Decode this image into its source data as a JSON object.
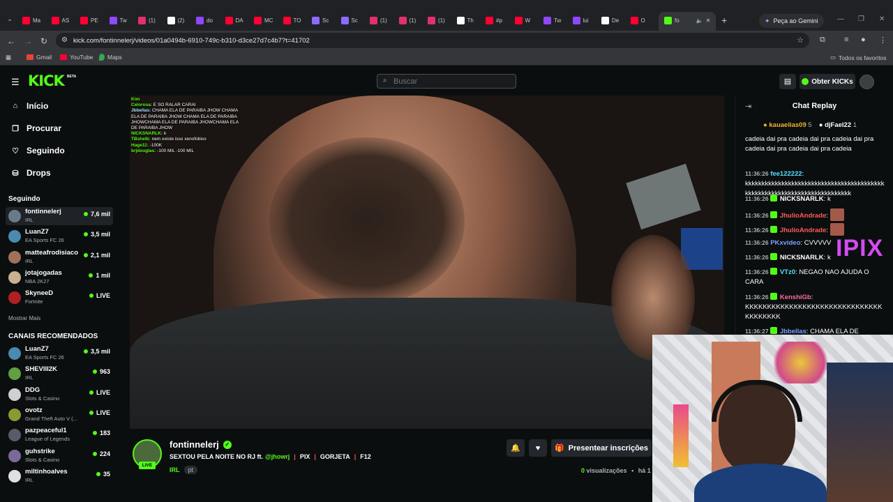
{
  "browser": {
    "tabs": [
      {
        "label": "Ma",
        "color": "#ff0033"
      },
      {
        "label": "AS",
        "color": "#ff0033"
      },
      {
        "label": "PE",
        "color": "#ff0033"
      },
      {
        "label": "Tw",
        "color": "#9146ff"
      },
      {
        "label": "(1)",
        "color": "#e1306c"
      },
      {
        "label": "(2)",
        "color": "#ffffff"
      },
      {
        "label": "do",
        "color": "#9146ff"
      },
      {
        "label": "DA",
        "color": "#ff0033"
      },
      {
        "label": "MC",
        "color": "#ff0033"
      },
      {
        "label": "TO",
        "color": "#ff0033"
      },
      {
        "label": "Sc",
        "color": "#8a6cff"
      },
      {
        "label": "Sc",
        "color": "#8a6cff"
      },
      {
        "label": "(1)",
        "color": "#e1306c"
      },
      {
        "label": "(1)",
        "color": "#e1306c"
      },
      {
        "label": "(1)",
        "color": "#e1306c"
      },
      {
        "label": "Th",
        "color": "#ffffff"
      },
      {
        "label": "#p",
        "color": "#ff0033"
      },
      {
        "label": "W",
        "color": "#ff0033"
      },
      {
        "label": "Tw",
        "color": "#9146ff"
      },
      {
        "label": "lui",
        "color": "#9146ff"
      },
      {
        "label": "De",
        "color": "#ffffff"
      },
      {
        "label": "O",
        "color": "#ff0033"
      }
    ],
    "active_tab": {
      "label": "fo",
      "color": "#53fc18"
    },
    "gemini_label": "Peça ao Gemini",
    "url": "kick.com/fontinnelerj/videos/01a0494b-6910-749c-b310-d3ce27d7c4b7?t=41702",
    "bookmarks": [
      {
        "label": "Gmail",
        "color": "#ea4335"
      },
      {
        "label": "YouTube",
        "color": "#ff0033"
      },
      {
        "label": "Maps",
        "color": "#34a853"
      }
    ],
    "all_favorites": "Todos os favoritos"
  },
  "kick": {
    "logo": "KICK",
    "beta": "BETA",
    "search_placeholder": "Buscar",
    "get_kicks": "Obter KICKs"
  },
  "sidebar": {
    "nav": [
      {
        "label": "Início",
        "icon": "home-icon",
        "glyph": "⌂"
      },
      {
        "label": "Procurar",
        "icon": "browse-icon",
        "glyph": "❐"
      },
      {
        "label": "Seguindo",
        "icon": "heart-icon",
        "glyph": "♡"
      },
      {
        "label": "Drops",
        "icon": "drops-icon",
        "glyph": "⛁"
      }
    ],
    "following_title": "Seguindo",
    "following": [
      {
        "name": "fontinnelerj",
        "category": "IRL",
        "viewers": "7,6 mil",
        "color": "#6a7a88"
      },
      {
        "name": "LuanZ7",
        "category": "EA Sports FC 26",
        "viewers": "3,5 mil",
        "color": "#4a8ab0"
      },
      {
        "name": "matteafrodisiaco",
        "category": "IRL",
        "viewers": "2,1 mil",
        "color": "#a0705a"
      },
      {
        "name": "jotajogadas",
        "category": "NBA 2K27",
        "viewers": "1 mil",
        "color": "#c8b090"
      },
      {
        "name": "SkyneeD",
        "category": "Fortnite",
        "viewers": "LIVE",
        "color": "#b02020"
      }
    ],
    "show_more": "Mostrar Mais",
    "recommended_title": "CANAIS RECOMENDADOS",
    "recommended": [
      {
        "name": "LuanZ7",
        "category": "EA Sports FC 26",
        "viewers": "3,5 mil",
        "color": "#4a8ab0"
      },
      {
        "name": "SHEVIII2K",
        "category": "IRL",
        "viewers": "963",
        "color": "#60a040"
      },
      {
        "name": "DDG",
        "category": "Slots & Casino",
        "viewers": "LIVE",
        "color": "#d0d0d0"
      },
      {
        "name": "ovotz",
        "category": "Grand Theft Auto V (...",
        "viewers": "LIVE",
        "color": "#8a9a30"
      },
      {
        "name": "pazpeaceful1",
        "category": "League of Legends",
        "viewers": "183",
        "color": "#5a5a6a"
      },
      {
        "name": "guhstrike",
        "category": "Slots & Casino",
        "viewers": "224",
        "color": "#7a6a9a"
      },
      {
        "name": "miltinhoalves",
        "category": "IRL",
        "viewers": "35",
        "color": "#e0e0e0"
      }
    ]
  },
  "video_overlay": [
    {
      "user": "Kim",
      "text": ""
    },
    {
      "user": "Celorosa:",
      "text": "E SO RALAR CARAI"
    },
    {
      "user": "Jbbellas:",
      "text": "CHAMA ELA DE PARAIBA JHOW CHAMA ELA DE PARAIBA JHOW CHAMA ELA DE PARAIBA JHOWCHAMA ELA DE PARAIBA JHOWCHAMA ELA DE PARAIBA JHOW"
    },
    {
      "user": "NICKSNARLK:",
      "text": "k"
    },
    {
      "user": "TBshelb:",
      "text": "nem existe isso xenofobico"
    },
    {
      "user": "Hage11:",
      "text": "-100K"
    },
    {
      "user": "brjdouglas:",
      "text": "-100 MIL -100 MIL"
    }
  ],
  "stream": {
    "name": "fontinnelerj",
    "live": "LIVE",
    "title_parts": {
      "main": "SEXTOU PELA NOITE NO RJ ft.",
      "mention": "@jhowrj",
      "t1": "PIX",
      "t2": "GORJETA",
      "t3": "F12",
      "sep": "|"
    },
    "category": "IRL",
    "language": "pt",
    "gift_label": "Presentear inscrições",
    "views_count": "0",
    "views_label": "visualizações",
    "ago": "há 1"
  },
  "chat": {
    "title": "Chat Replay",
    "gifters": [
      {
        "name": "kauaelias09",
        "count": "5"
      },
      {
        "name": "djFael22",
        "count": "1"
      }
    ],
    "messages": [
      {
        "ts": "",
        "user": "",
        "color": "#ffffff",
        "text": "cadeia dai pra cadeia dai pra cadeia dai pra cadeia dai pra cadeia dai pra cadeia"
      },
      {
        "ts": "11:36:26",
        "user": "fee122222",
        "color": "#53e0ff",
        "text": "kkkkkkkkkkkkkkkkkkkkkkkkkkkkkkkkkkkkkkkkkkkkkkkkkkkkkkkkkkkkkkkkkkkkkkkkkk"
      },
      {
        "ts": "11:36:26",
        "user": "NICKSNARLK",
        "color": "#ffffff",
        "text": "k"
      },
      {
        "ts": "11:36:26",
        "user": "JhulioAndrade",
        "color": "#ff5a5a",
        "text": ""
      },
      {
        "ts": "11:36:26",
        "user": "JhulioAndrade",
        "color": "#ff5a5a",
        "text": ""
      },
      {
        "ts": "11:36:26",
        "user": "PKxvideo",
        "color": "#7aa0ff",
        "text": "CVVVVV"
      },
      {
        "ts": "11:36:26",
        "user": "NICKSNARLK",
        "color": "#ffffff",
        "text": "k"
      },
      {
        "ts": "11:36:26",
        "user": "VTz0",
        "color": "#53e0ff",
        "text": "NEGAO NAO AJUDA O CARA"
      },
      {
        "ts": "11:36:26",
        "user": "KenshiGb",
        "color": "#ff6aa0",
        "text": "KKKKKKKKKKKKKKKKKKKKKKKKKKKKKKKKKKKKKKK"
      },
      {
        "ts": "11:36:27",
        "user": "Jbbellas",
        "color": "#7aa0ff",
        "text": "CHAMA ELA DE"
      }
    ],
    "ipix": "IPIX"
  }
}
